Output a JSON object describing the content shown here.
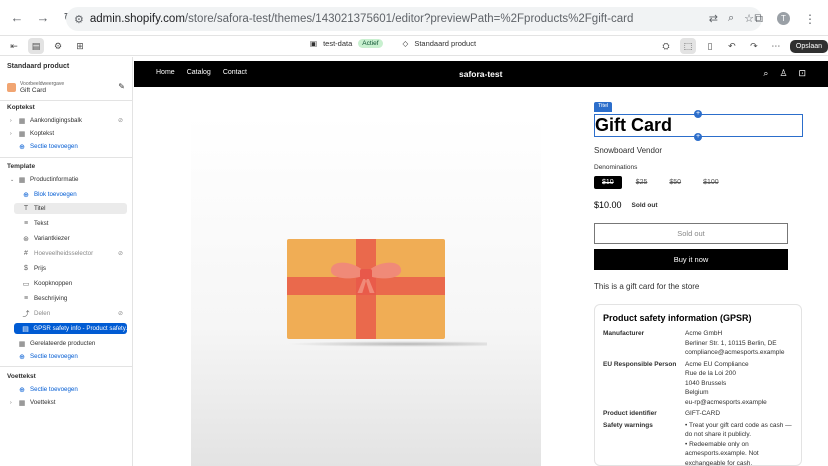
{
  "browser": {
    "url_host": "admin.shopify.com",
    "url_path": "/store/safora-test/themes/143021375601/editor?previewPath=%2Fproducts%2Fgift-card",
    "avatar_letter": "T"
  },
  "toolbar": {
    "theme_name": "test-data",
    "theme_status": "Actief",
    "template_name": "Standaard product",
    "save_label": "Opslaan"
  },
  "sidebar": {
    "heading": "Standaard product",
    "preview_caption": "Voorbeeldweergave",
    "preview_product": "Gift Card",
    "header_section": "Koptekst",
    "header_items": [
      "Aankondigingsbalk",
      "Koptekst"
    ],
    "add_section": "Sectie toevoegen",
    "template_section": "Template",
    "product_info": "Productinformatie",
    "add_block": "Blok toevoegen",
    "blocks": [
      "Titel",
      "Tekst",
      "Variantkiezer",
      "Hoeveelheidsselector",
      "Prijs",
      "Koopknoppen",
      "Beschrijving",
      "Delen"
    ],
    "gpsr_block": "GPSR safety info - Product safety...",
    "related": "Gerelateerde producten",
    "footer_section": "Voettekst",
    "footer_item": "Voettekst"
  },
  "store": {
    "nav_links": [
      "Home",
      "Catalog",
      "Contact"
    ],
    "brand": "safora-test",
    "title_tag": "Titel",
    "product_title": "Gift Card",
    "vendor": "Snowboard Vendor",
    "denom_label": "Denominations",
    "denominations": [
      "$10",
      "$25",
      "$50",
      "$100"
    ],
    "price": "$10.00",
    "price_badge": "Sold out",
    "soldout_button": "Sold out",
    "buy_button": "Buy it now",
    "description": "This is a gift card for the store",
    "gpsr_title": "Product safety information (GPSR)",
    "gpsr": [
      {
        "k": "Manufacturer",
        "v": [
          "Acme GmbH",
          "Berliner Str. 1, 10115 Berlin, DE",
          "compliance@acmesports.example"
        ]
      },
      {
        "k": "EU Responsible Person",
        "v": [
          "Acme EU Compliance",
          "Rue de la Loi 200",
          "1040 Brussels",
          "Belgium",
          "eu-rp@acmesports.example"
        ]
      },
      {
        "k": "Product identifier",
        "v": [
          "GIFT-CARD"
        ]
      },
      {
        "k": "Safety warnings",
        "v": [
          "• Treat your gift card code as cash —",
          "do not share it publicly.",
          "• Redeemable only on",
          "acmesports.example. Not",
          "exchangeable for cash."
        ]
      }
    ]
  },
  "colors": {
    "accent": "#005bd3",
    "box": "#f0ad55",
    "ribbon": "#e8584a"
  }
}
